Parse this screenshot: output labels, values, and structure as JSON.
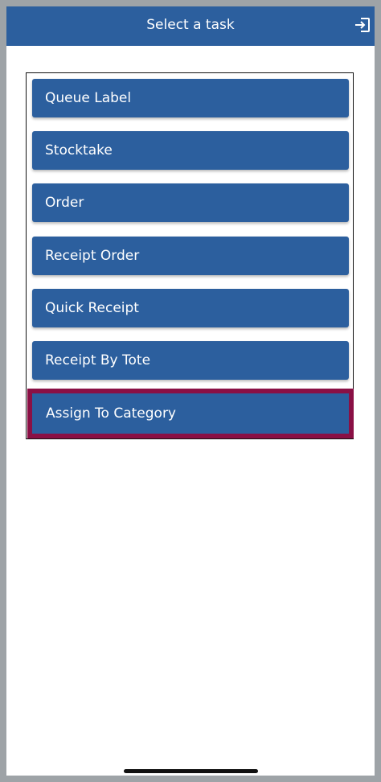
{
  "header": {
    "title": "Select a task",
    "logout_icon": "logout-icon"
  },
  "tasks": [
    {
      "label": "Queue Label"
    },
    {
      "label": "Stocktake"
    },
    {
      "label": "Order"
    },
    {
      "label": "Receipt Order"
    },
    {
      "label": "Quick Receipt"
    },
    {
      "label": "Receipt By Tote"
    },
    {
      "label": "Assign To Category",
      "selected": true
    }
  ],
  "colors": {
    "primary": "#2c5f9e",
    "highlight": "#8a1045",
    "frame": "#9ea3a7"
  }
}
